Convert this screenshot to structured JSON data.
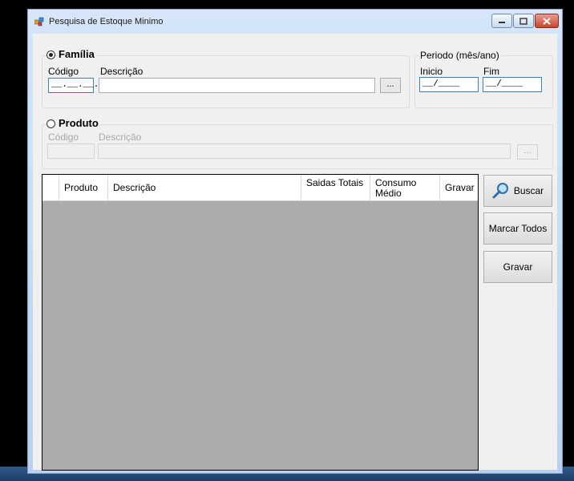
{
  "window": {
    "title": "Pesquisa de Estoque Minimo"
  },
  "familia": {
    "radio_label": "Família",
    "checked": true,
    "codigo_label": "Código",
    "codigo_value": "__.__.__.__",
    "descricao_label": "Descrição",
    "descricao_value": "",
    "lookup_label": "..."
  },
  "periodo": {
    "title": "Periodo (mês/ano)",
    "inicio_label": "Inicio",
    "inicio_value": "__/____",
    "fim_label": "Fim",
    "fim_value": "__/____"
  },
  "produto": {
    "radio_label": "Produto",
    "checked": false,
    "codigo_label": "Código",
    "descricao_label": "Descrição",
    "lookup_label": "..."
  },
  "grid": {
    "columns": [
      "Produto",
      "Descrição",
      "Saidas Totais",
      "Consumo Médio",
      "Gravar"
    ]
  },
  "buttons": {
    "buscar": "Buscar",
    "marcar_todos": "Marcar Todos",
    "gravar": "Gravar"
  },
  "colors": {
    "grid_body": "#ababab",
    "window_frame": "#b9d1ec",
    "close_button": "#c64632"
  }
}
